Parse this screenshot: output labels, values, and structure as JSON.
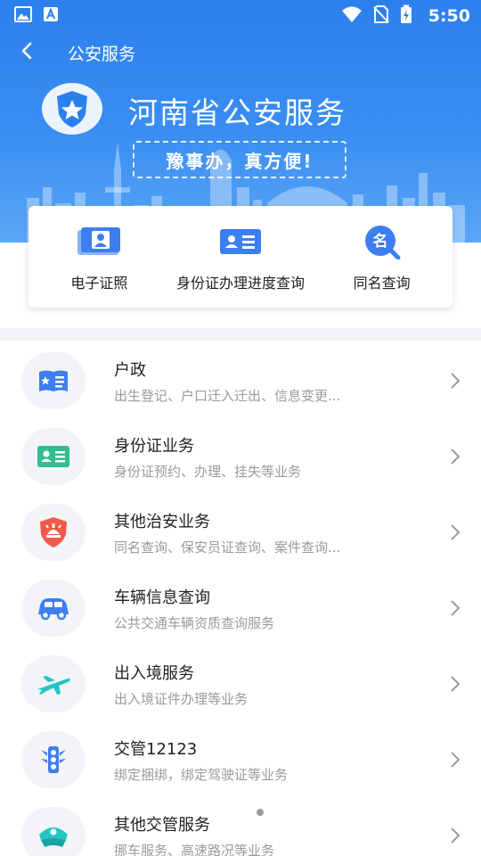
{
  "status_bar": {
    "time": "5:50",
    "left_icons": [
      "gallery-icon",
      "app-a-icon"
    ],
    "right_icons": [
      "wifi-icon",
      "no-sim-icon",
      "battery-charging-icon"
    ]
  },
  "nav": {
    "title": "公安服务",
    "back_icon": "back-arrow-icon"
  },
  "banner": {
    "title": "河南省公安服务",
    "slogan": "豫事办，真方便!"
  },
  "quick_actions": [
    {
      "label": "电子证照",
      "icon": "e-license-icon"
    },
    {
      "label": "身份证办理进度查询",
      "icon": "id-card-progress-icon"
    },
    {
      "label": "同名查询",
      "icon": "name-search-icon"
    }
  ],
  "services": [
    {
      "title": "户政",
      "desc": "出生登记、户口迁入迁出、信息变更...",
      "icon": "household-book-icon"
    },
    {
      "title": "身份证业务",
      "desc": "身份证预约、办理、挂失等业务",
      "icon": "id-card-icon"
    },
    {
      "title": "其他治安业务",
      "desc": "同名查询、保安员证查询、案件查询...",
      "icon": "police-shield-icon"
    },
    {
      "title": "车辆信息查询",
      "desc": "公共交通车辆资质查询服务",
      "icon": "vehicle-icon"
    },
    {
      "title": "出入境服务",
      "desc": "出入境证件办理等业务",
      "icon": "airplane-icon"
    },
    {
      "title": "交管12123",
      "desc": "绑定捆绑，绑定驾驶证等业务",
      "icon": "traffic-light-icon"
    },
    {
      "title": "其他交管服务",
      "desc": "挪车服务、高速路况等业务",
      "icon": "traffic-police-hat-icon"
    }
  ],
  "colors": {
    "header_blue": "#2c80ee",
    "icon_blue": "#3d7ef0",
    "icon_green": "#2fbf8f",
    "icon_red": "#f05a4a",
    "icon_cyan": "#25c4c4"
  }
}
